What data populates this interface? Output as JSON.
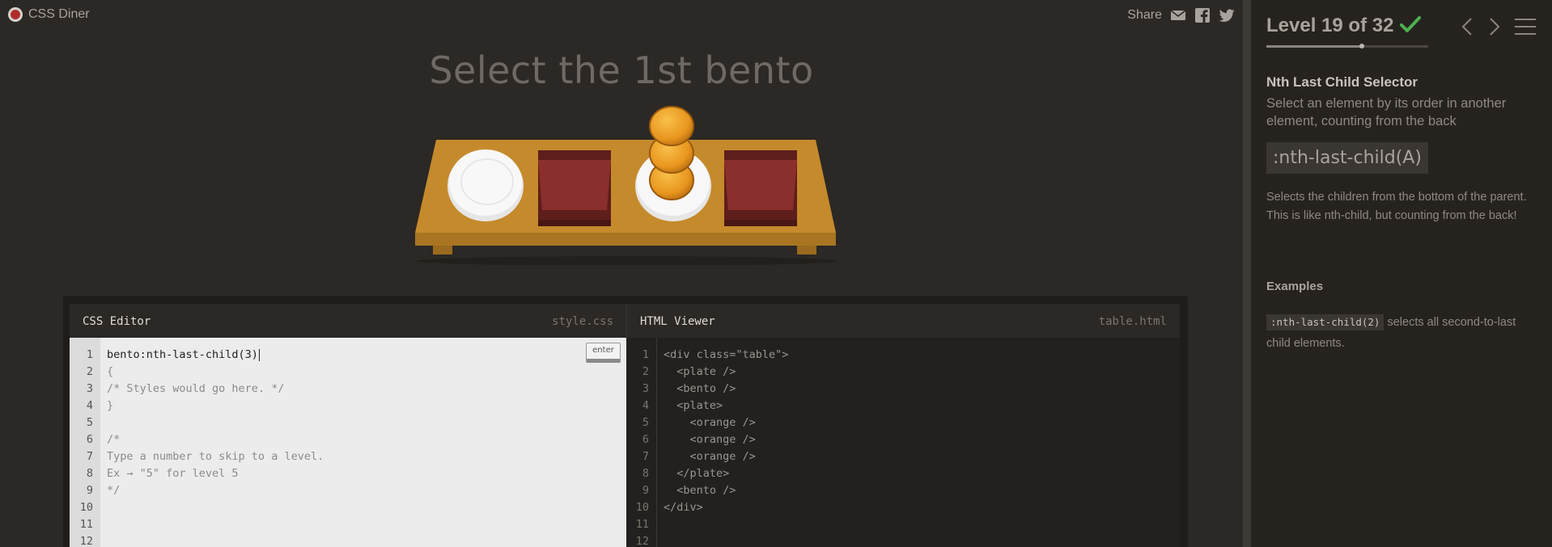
{
  "app": {
    "logo_text": "CSS Diner",
    "share_label": "Share"
  },
  "share_icons": [
    "mail-icon",
    "facebook-icon",
    "twitter-icon"
  ],
  "order_text": "Select the 1st bento",
  "table_items": [
    "plate",
    "bento",
    "plate-with-oranges",
    "bento"
  ],
  "css_editor": {
    "title": "CSS Editor",
    "filename": "style.css",
    "enter_label": "enter",
    "input_value": "bento:nth-last-child(3)",
    "line_numbers": [
      "1",
      "2",
      "3",
      "4",
      "5",
      "6",
      "7",
      "8",
      "9",
      "10",
      "11",
      "12"
    ],
    "lines": [
      "{",
      "/* Styles would go here. */",
      "}",
      "",
      "/*",
      "Type a number to skip to a level.",
      "Ex → \"5\" for level 5",
      "*/",
      "",
      "",
      ""
    ]
  },
  "html_viewer": {
    "title": "HTML Viewer",
    "filename": "table.html",
    "line_numbers": [
      "1",
      "2",
      "3",
      "4",
      "5",
      "6",
      "7",
      "8",
      "9",
      "10",
      "11",
      "12"
    ],
    "lines": [
      "<div class=\"table\">",
      "  <plate />",
      "  <bento />",
      "  <plate>",
      "    <orange />",
      "    <orange />",
      "    <orange />",
      "  </plate>",
      "  <bento />",
      "</div>",
      "",
      ""
    ]
  },
  "sidebar": {
    "level_title": "Level 19 of 32",
    "level_progress": 0.59,
    "completed": true,
    "selector_name": "Nth Last Child Selector",
    "selector_desc": "Select an element by its order in another element, counting from the back",
    "syntax": ":nth-last-child(A)",
    "hint": "Selects the children from the bottom of the parent. This is like nth-child, but counting from the back!",
    "examples_title": "Examples",
    "example_code": ":nth-last-child(2)",
    "example_text": "selects all second-to-last child elements."
  },
  "colors": {
    "background": "#2b2825",
    "sidebar": "#26231f",
    "check": "#4caf50",
    "plate": "#f2f2f2",
    "bento": "#7a2a28",
    "orange": "#e8961e",
    "table": "#c58a2c"
  }
}
